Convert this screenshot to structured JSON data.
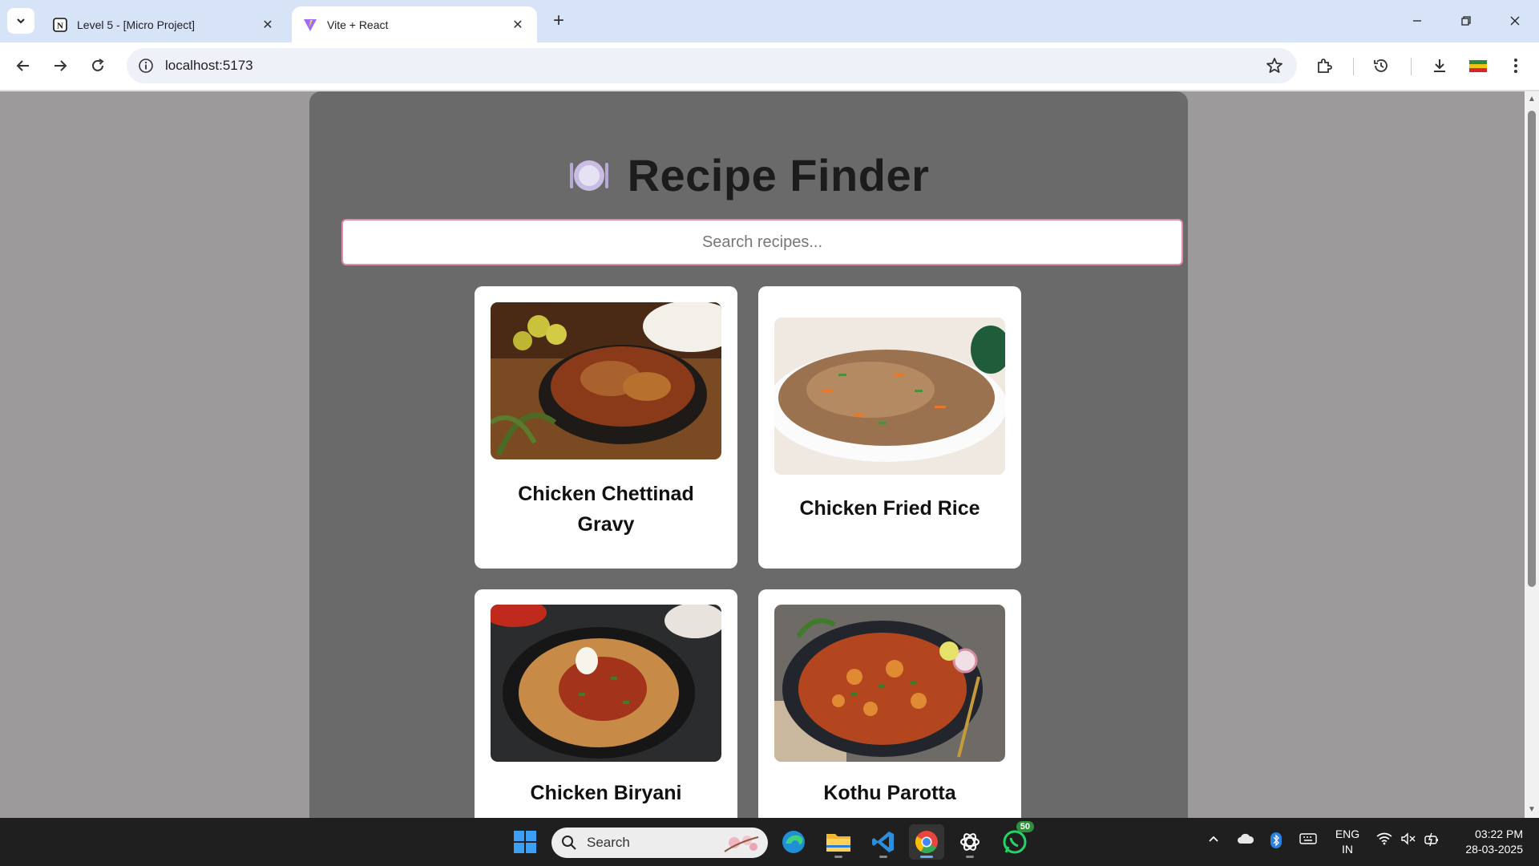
{
  "browser": {
    "tabs": [
      {
        "title": "Level 5 - [Micro Project]",
        "icon": "notion-icon",
        "active": false
      },
      {
        "title": "Vite + React",
        "icon": "vite-icon",
        "active": true
      }
    ],
    "url": "localhost:5173"
  },
  "app": {
    "title": "Recipe Finder",
    "title_icon": "plate-icon",
    "search_placeholder": "Search recipes...",
    "accent_color": "#e78ba3",
    "recipes": [
      {
        "name": "Chicken Chettinad Gravy"
      },
      {
        "name": "Chicken Fried Rice"
      },
      {
        "name": "Chicken Biryani"
      },
      {
        "name": "Kothu Parotta"
      }
    ]
  },
  "taskbar": {
    "search_label": "Search",
    "whatsapp_badge": "50",
    "lang_line1": "ENG",
    "lang_line2": "IN",
    "time": "03:22 PM",
    "date": "28-03-2025"
  }
}
